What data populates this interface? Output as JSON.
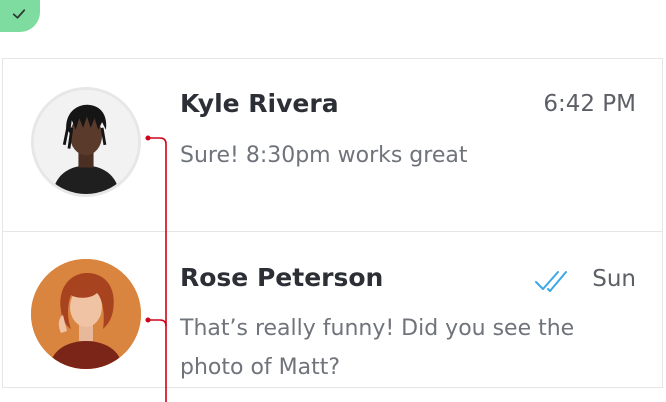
{
  "badge": {
    "icon": "check-icon",
    "color": "#7fdca0"
  },
  "conversations": [
    {
      "name": "Kyle Rivera",
      "time": "6:42 PM",
      "preview": "Sure! 8:30pm works great",
      "read": false
    },
    {
      "name": "Rose Peterson",
      "time": "Sun",
      "preview": "That’s really funny! Did you see the photo of Matt?",
      "read": true,
      "read_icon": "double-check-icon",
      "read_color": "#3aa7e6"
    }
  ],
  "colors": {
    "annotation_line": "#d0021b",
    "divider": "#e6e6e6"
  }
}
